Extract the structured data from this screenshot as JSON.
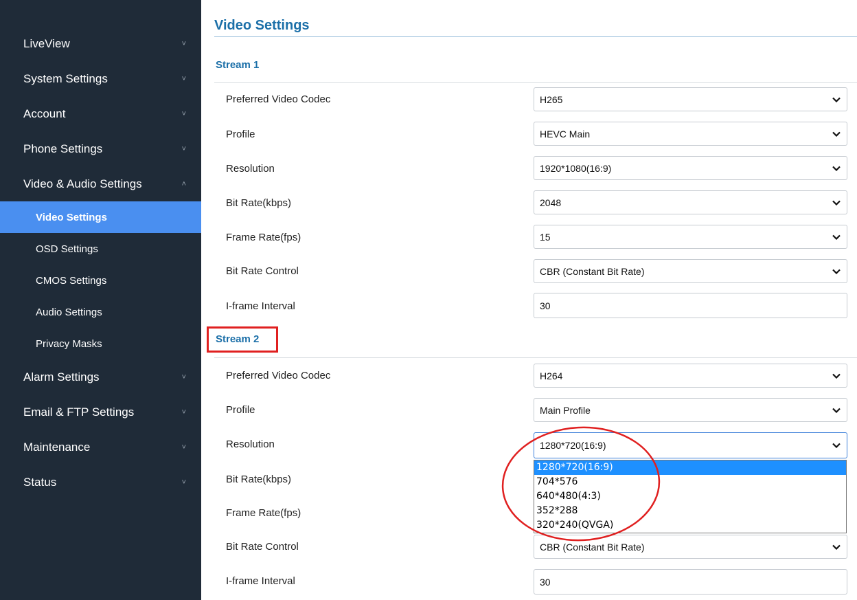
{
  "sidebar": {
    "items": [
      {
        "label": "LiveView",
        "chevron": "˅"
      },
      {
        "label": "System Settings",
        "chevron": "˅"
      },
      {
        "label": "Account",
        "chevron": "˅"
      },
      {
        "label": "Phone Settings",
        "chevron": "˅"
      },
      {
        "label": "Video & Audio Settings",
        "chevron": "˄"
      }
    ],
    "sub_items": [
      {
        "label": "Video Settings"
      },
      {
        "label": "OSD Settings"
      },
      {
        "label": "CMOS Settings"
      },
      {
        "label": "Audio Settings"
      },
      {
        "label": "Privacy Masks"
      }
    ],
    "items_after": [
      {
        "label": "Alarm Settings",
        "chevron": "˅"
      },
      {
        "label": "Email & FTP Settings",
        "chevron": "˅"
      },
      {
        "label": "Maintenance",
        "chevron": "˅"
      },
      {
        "label": "Status",
        "chevron": "˅"
      }
    ]
  },
  "page": {
    "title": "Video Settings"
  },
  "stream1": {
    "title": "Stream 1",
    "rows": [
      {
        "label": "Preferred Video Codec",
        "value": "H265"
      },
      {
        "label": "Profile",
        "value": "HEVC Main"
      },
      {
        "label": "Resolution",
        "value": "1920*1080(16:9)"
      },
      {
        "label": "Bit Rate(kbps)",
        "value": "2048"
      },
      {
        "label": "Frame Rate(fps)",
        "value": "15"
      },
      {
        "label": "Bit Rate Control",
        "value": "CBR (Constant Bit Rate)"
      },
      {
        "label": "I-frame Interval",
        "value": "30"
      }
    ]
  },
  "stream2": {
    "title": "Stream 2",
    "rows": [
      {
        "label": "Preferred Video Codec",
        "value": "H264"
      },
      {
        "label": "Profile",
        "value": "Main Profile"
      },
      {
        "label": "Resolution",
        "value": "1280*720(16:9)"
      },
      {
        "label": "Bit Rate(kbps)",
        "value": ""
      },
      {
        "label": "Frame Rate(fps)",
        "value": ""
      },
      {
        "label": "Bit Rate Control",
        "value": "CBR (Constant Bit Rate)"
      },
      {
        "label": "I-frame Interval",
        "value": "30"
      }
    ],
    "resolution_options": [
      "1280*720(16:9)",
      "704*576",
      "640*480(4:3)",
      "352*288",
      "320*240(QVGA)"
    ]
  },
  "colors": {
    "sidebar_bg": "#1f2b38",
    "active_item": "#4a8ff0",
    "title_blue": "#1b6fa8",
    "annotation_red": "#e02020",
    "dropdown_selected": "#1e90ff"
  }
}
